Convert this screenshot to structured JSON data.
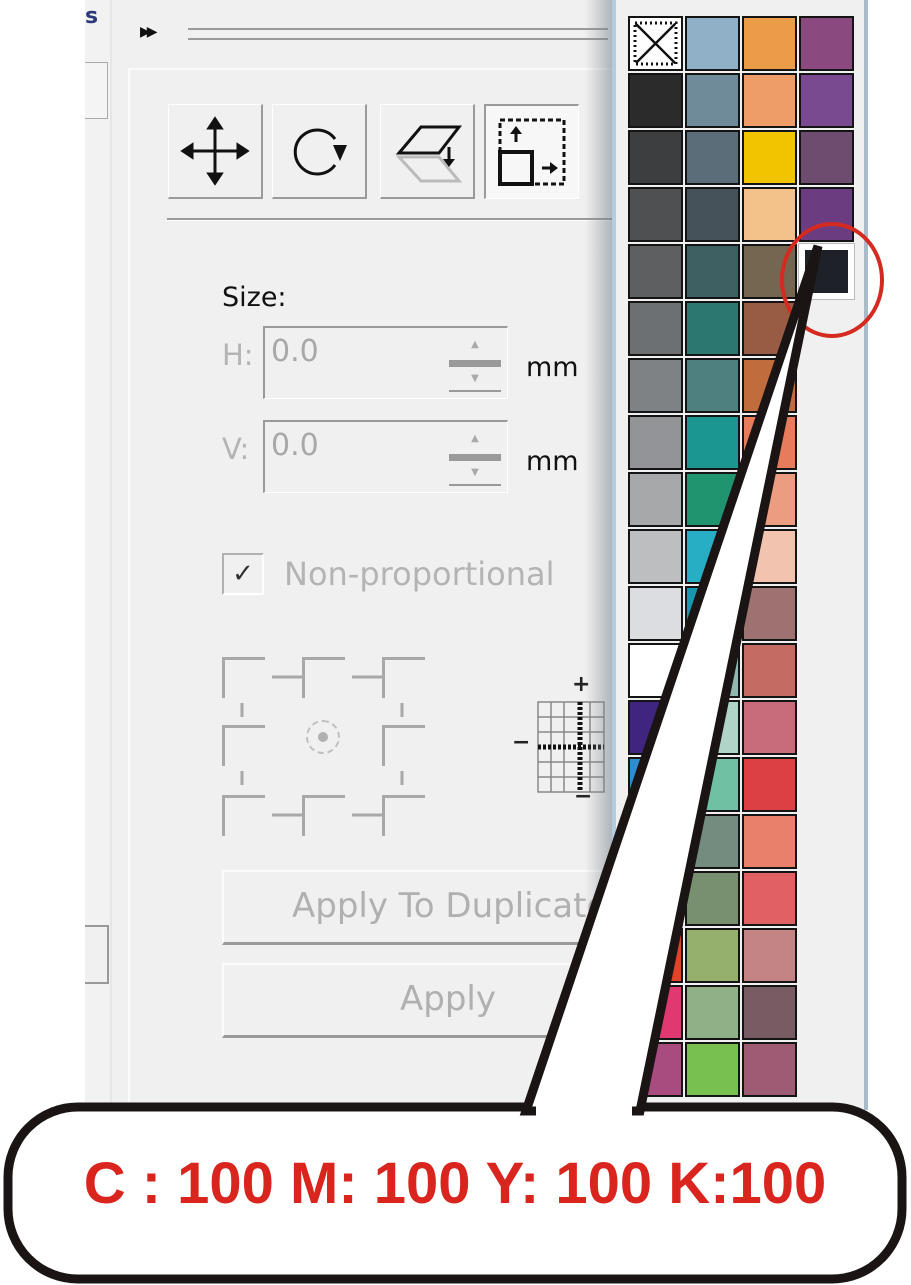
{
  "left_strip": {
    "label_fragment": "s"
  },
  "toolbar": {
    "expand_icon": "double-chevron-right",
    "tools": [
      {
        "name": "position",
        "icon": "move-arrows-icon"
      },
      {
        "name": "rotate",
        "icon": "rotate-icon"
      },
      {
        "name": "mirror",
        "icon": "mirror-icon"
      },
      {
        "name": "size",
        "icon": "size-icon",
        "active": true
      }
    ]
  },
  "size": {
    "heading": "Size:",
    "h_label": "H:",
    "h_value": "0.0",
    "h_unit": "mm",
    "v_label": "V:",
    "v_value": "0.0",
    "v_unit": "mm"
  },
  "non_proportional": {
    "label": "Non-proportional",
    "checked": true,
    "check_glyph": "✓"
  },
  "anchor": {
    "selected": "center"
  },
  "nudge": {
    "plus": "+",
    "minus": "−"
  },
  "buttons": {
    "apply_duplicate": "Apply To Duplicate",
    "apply": "Apply"
  },
  "palette": {
    "columns": [
      [
        "none",
        "#2b2b2b",
        "#3c3e40",
        "#4e5052",
        "#5d5f61",
        "#6d7073",
        "#7f8285",
        "#929497",
        "#a6a8aa",
        "#bcbec0",
        "#dcdde0",
        "#ffffff",
        "#3f2580",
        "#2e8dd0",
        "#2d6fb8",
        "#f2e020",
        "#e04428",
        "#e03870",
        "#a84c80"
      ],
      [
        "#8fb0c6",
        "#6f8a98",
        "#5a6d78",
        "#45525a",
        "#3f6062",
        "#2c7870",
        "#4e8080",
        "#1c9690",
        "#20946e",
        "#28aec4",
        "#1898b0",
        "#90b8b0",
        "#b0d4c8",
        "#70c0a4",
        "#748c80",
        "#789070",
        "#94b06c",
        "#90b088",
        "#78c050"
      ],
      [
        "#ec9c48",
        "#ee9c68",
        "#f2c400",
        "#f2c28a",
        "#746650",
        "#985c44",
        "#c06c3c",
        "#e67c5c",
        "#ec9c80",
        "#f2c4b0",
        "#9e7270",
        "#c46c64",
        "#c86c7c",
        "#dc4044",
        "#e8806c",
        "#e06064",
        "#c48486",
        "#785c64",
        "#9e5c74"
      ],
      [
        "#8a4a80",
        "#7a4a90",
        "#6e4c70",
        "#6c3c80"
      ]
    ],
    "selected_color": "#1e2228",
    "highlight_color": "#d42a1f"
  },
  "callout": {
    "text": "C : 100 M: 100 Y: 100 K:100",
    "text_color": "#d9251d"
  }
}
